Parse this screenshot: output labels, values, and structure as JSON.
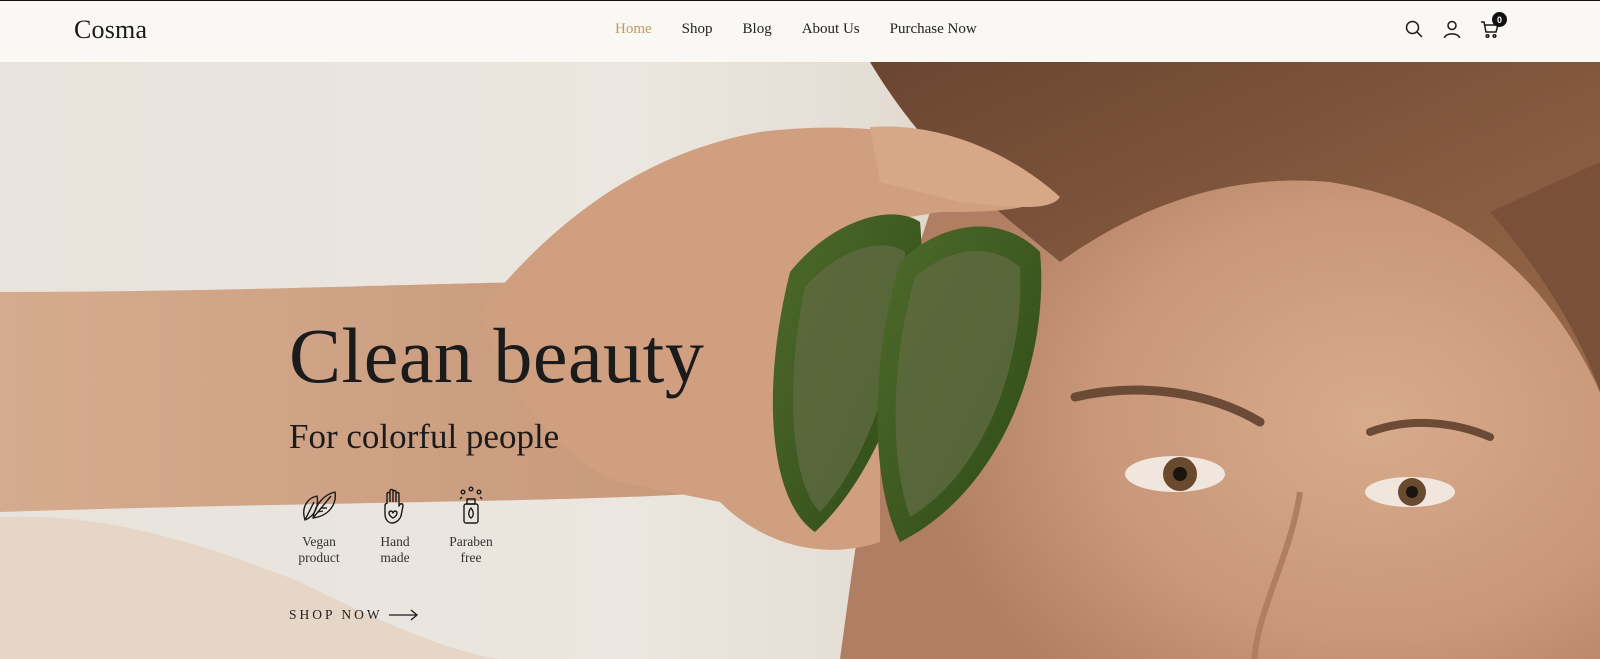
{
  "brand": {
    "logo": "Cosma"
  },
  "nav": {
    "items": [
      {
        "label": "Home",
        "active": true
      },
      {
        "label": "Shop",
        "active": false
      },
      {
        "label": "Blog",
        "active": false
      },
      {
        "label": "About Us",
        "active": false
      },
      {
        "label": "Purchase Now",
        "active": false
      }
    ],
    "active_color": "#c19a5b"
  },
  "header_icons": {
    "search": "search-icon",
    "account": "user-icon",
    "cart": "cart-icon",
    "cart_count": "0"
  },
  "hero": {
    "headline": "Clean beauty",
    "subheadline": "For colorful people",
    "features": [
      {
        "icon": "leaf-icon",
        "label": "Vegan\nproduct"
      },
      {
        "icon": "hand-icon",
        "label": "Hand\nmade"
      },
      {
        "icon": "bottle-icon",
        "label": "Paraben\nfree"
      }
    ],
    "cta_label": "SHOP NOW",
    "cta_icon": "arrow-right-icon",
    "image": "woman holding aloe vera halves beside face"
  }
}
